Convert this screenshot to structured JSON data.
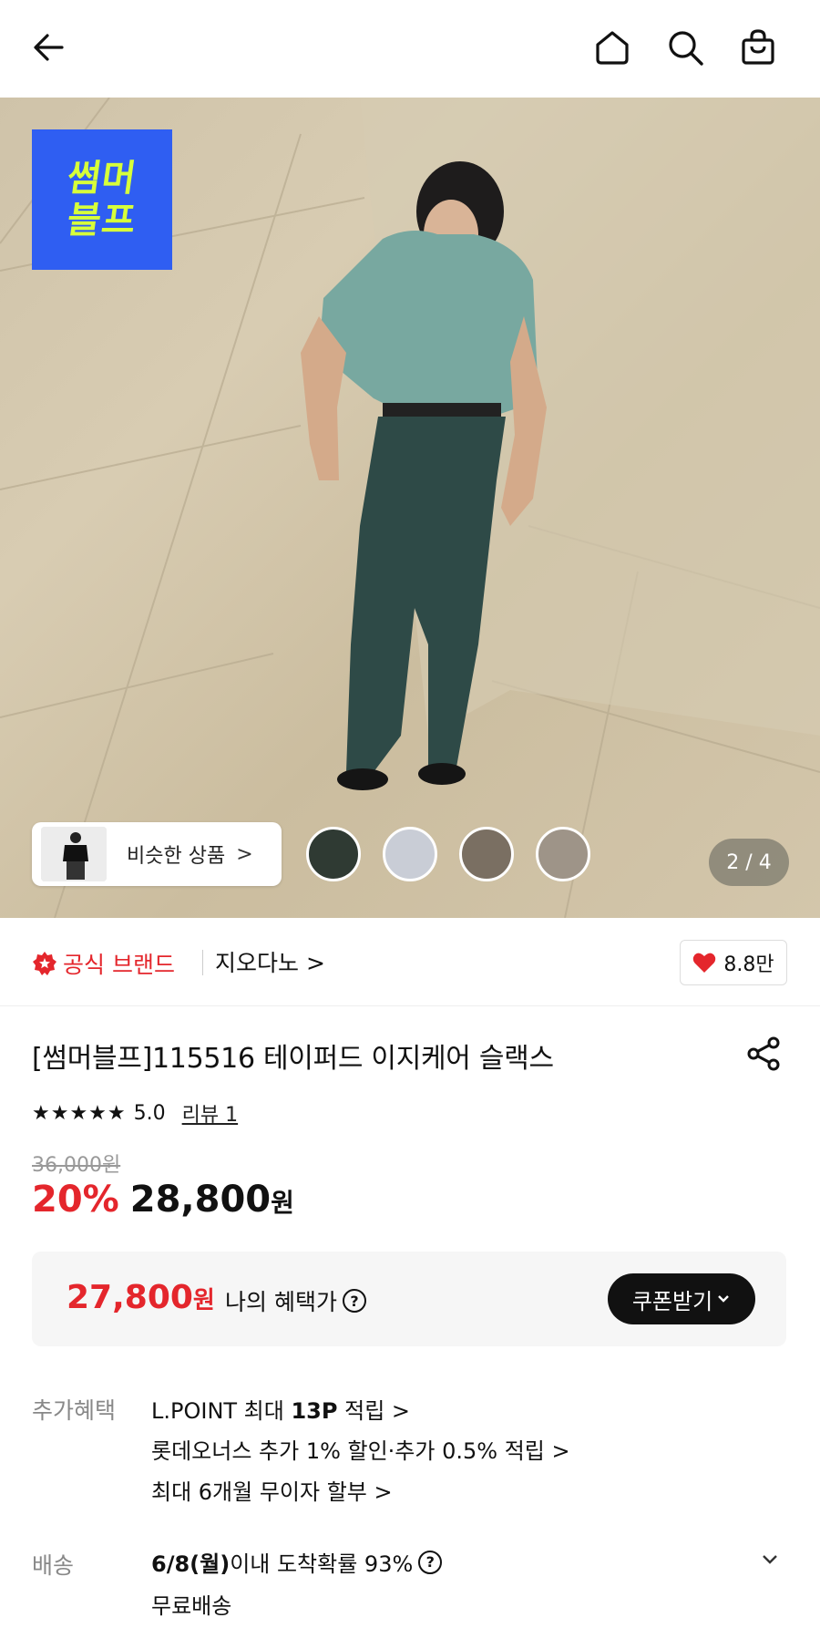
{
  "header": {
    "back_icon": "arrow-left-icon",
    "home_icon": "home-icon",
    "search_icon": "search-icon",
    "bag_icon": "shopping-bag-icon"
  },
  "hero": {
    "promo_badge": {
      "line1": "썸머",
      "line2": "블프"
    },
    "similar_label": "비슷한 상품",
    "similar_chevron": ">",
    "swatch_colors": [
      "#2f3a33",
      "#c9cdd6",
      "#7a6f62",
      "#9e9488"
    ],
    "counter": "2 / 4"
  },
  "brand": {
    "official_label": "공식 브랜드",
    "brand_name": "지오다노 >",
    "likes": "8.8만"
  },
  "product": {
    "title": "[썸머블프]115516 테이퍼드 이지케어 슬랙스",
    "stars": "★★★★★",
    "rating": "5.0",
    "review_link": "리뷰 1",
    "original_price": "36,000원",
    "discount": "20%",
    "price": "28,800",
    "price_unit": "원"
  },
  "benefit_box": {
    "price": "27,800",
    "price_unit": "원",
    "label": "나의 혜택가",
    "help": "?",
    "coupon_button": "쿠폰받기"
  },
  "extra_benefits": {
    "label": "추가혜택",
    "line1_prefix": "L.POINT 최대 ",
    "line1_bold": "13P",
    "line1_suffix": " 적립 >",
    "line2": "롯데오너스 추가 1% 할인·추가 0.5% 적립 >",
    "line3": "최대 6개월 무이자 할부 >"
  },
  "shipping": {
    "label": "배송",
    "date_bold": "6/8(월)",
    "date_rest": " 이내 도착확률 93%",
    "help": "?",
    "free": "무료배송"
  },
  "colors": {
    "accent_red": "#e4262c",
    "badge_blue": "#2f5ef2",
    "badge_text": "#d7ff3a"
  }
}
